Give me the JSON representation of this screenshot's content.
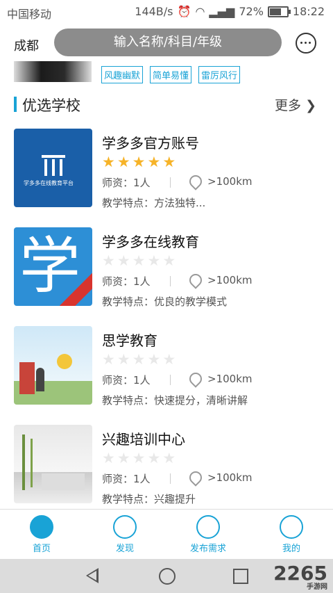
{
  "status": {
    "carrier": "中国移动",
    "speed": "144B/s",
    "battery": "72%",
    "time": "18:22"
  },
  "header": {
    "city": "成都",
    "search_placeholder": "输入名称/科目/年级"
  },
  "teacher_tags": [
    "风趣幽默",
    "简单易懂",
    "雷厉风行"
  ],
  "section": {
    "title": "优选学校",
    "more": "更多 ❯"
  },
  "schools": [
    {
      "name": "学多多官方账号",
      "rating": 5,
      "teachers": "师资：1人",
      "distance": ">100km",
      "feature": "教学特点：方法独特..."
    },
    {
      "name": "学多多在线教育",
      "rating": 0,
      "teachers": "师资：1人",
      "distance": ">100km",
      "feature": "教学特点：优良的教学模式"
    },
    {
      "name": "思学教育",
      "rating": 0,
      "teachers": "师资：1人",
      "distance": ">100km",
      "feature": "教学特点：快速提分，清晰讲解"
    },
    {
      "name": "兴趣培训中心",
      "rating": 0,
      "teachers": "师资：1人",
      "distance": ">100km",
      "feature": "教学特点：兴趣提升"
    }
  ],
  "logos": {
    "logo1_text": "学多多在线教育平台",
    "logo2_char": "学"
  },
  "tabs": [
    {
      "label": "首页",
      "icon": "home-icon"
    },
    {
      "label": "发现",
      "icon": "discover-icon"
    },
    {
      "label": "发布需求",
      "icon": "send-icon"
    },
    {
      "label": "我的",
      "icon": "user-icon"
    }
  ],
  "watermark": {
    "brand": "2265",
    "sub": "手游网"
  },
  "colors": {
    "accent": "#19a3d6",
    "star": "#f6b328",
    "search_bg": "#8c8c8c"
  }
}
